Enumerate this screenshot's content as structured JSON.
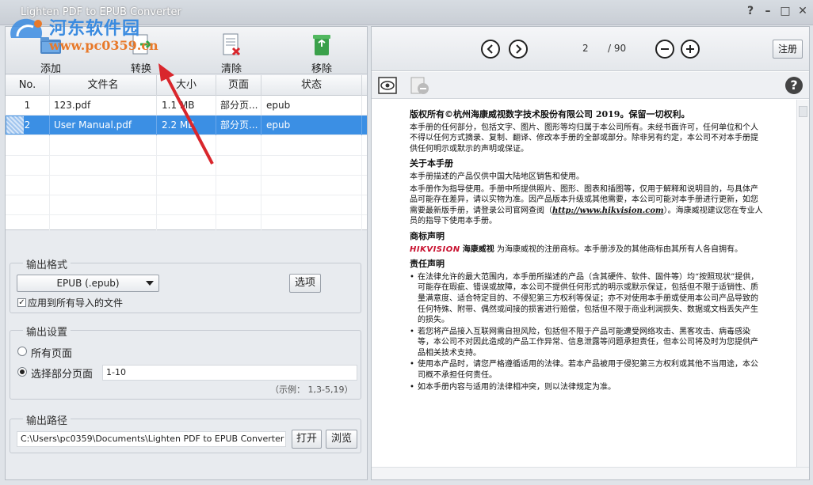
{
  "app": {
    "title": "Lighten PDF to EPUB Converter"
  },
  "watermark": {
    "name": "河东软件园",
    "url": "www.pc0359.cn"
  },
  "window_controls": {
    "help": "?",
    "minimize": "–",
    "maximize": "□",
    "close": "✕"
  },
  "toolbar": {
    "add_label": "添加",
    "convert_label": "转换",
    "clear_label": "清除",
    "remove_label": "移除"
  },
  "table": {
    "headers": {
      "no": "No.",
      "name": "文件名",
      "size": "大小",
      "pages": "页面",
      "status": "状态"
    },
    "rows": [
      {
        "no": "1",
        "name": "123.pdf",
        "size": "1.1 MB",
        "pages": "部分页...",
        "status": "epub"
      },
      {
        "no": "2",
        "name": "User Manual.pdf",
        "size": "2.2 MB",
        "pages": "部分页...",
        "status": "epub"
      }
    ]
  },
  "output_format": {
    "title": "输出格式",
    "selected": "EPUB (.epub)",
    "options_button": "选项",
    "apply_all_label": "应用到所有导入的文件"
  },
  "output_settings": {
    "title": "输出设置",
    "all_pages_label": "所有页面",
    "select_pages_label": "选择部分页面",
    "pages_value": "1-10",
    "example_hint": "（示例： 1,3-5,19）"
  },
  "output_path": {
    "title": "输出路径",
    "path_value": "C:\\Users\\pc0359\\Documents\\Lighten PDF to EPUB Converter",
    "open_button": "打开",
    "browse_button": "浏览"
  },
  "preview": {
    "current_page": "2",
    "total_pages": "/ 90",
    "register_button": "注册",
    "help_label": "?"
  },
  "document": {
    "copyright_title": "版权所有©杭州海康威视数字技术股份有限公司 2019。保留一切权利。",
    "copyright_body": "本手册的任何部分，包括文字、图片、图形等均归属于本公司所有。未经书面许可，任何单位和个人不得以任何方式摘录、复制、翻译、修改本手册的全部或部分。除非另有约定，本公司不对本手册提供任何明示或默示的声明或保证。",
    "about_title": "关于本手册",
    "about_p1": "本手册描述的产品仅供中国大陆地区销售和使用。",
    "about_p2_a": "本手册作为指导使用。手册中所提供照片、图形、图表和插图等，仅用于解释和说明目的，与具体产品可能存在差异，请以实物为准。因产品版本升级或其他需要，本公司可能对本手册进行更新，如您需要最新版手册，请登录公司官网查阅（",
    "about_url": "http://www.hikvision.com",
    "about_p2_b": "）。海康威视建议您在专业人员的指导下使用本手册。",
    "trademark_title": "商标声明",
    "brand_en": "HIKVISION",
    "brand_cn": "海康威视",
    "trademark_body": "为海康威视的注册商标。本手册涉及的其他商标由其所有人各自拥有。",
    "liability_title": "责任声明",
    "liability_items": [
      "在法律允许的最大范围内，本手册所描述的产品（含其硬件、软件、固件等）均“按照现状”提供，可能存在瑕疵、错误或故障，本公司不提供任何形式的明示或默示保证，包括但不限于适销性、质量满意度、适合特定目的、不侵犯第三方权利等保证；亦不对使用本手册或使用本公司产品导致的任何特殊、附带、偶然或间接的损害进行赔偿，包括但不限于商业利润损失、数据或文档丢失产生的损失。",
      "若您将产品接入互联网需自担风险，包括但不限于产品可能遭受网络攻击、黑客攻击、病毒感染等，本公司不对因此造成的产品工作异常、信息泄露等问题承担责任，但本公司将及时为您提供产品相关技术支持。",
      "使用本产品时，请您严格遵循适用的法律。若本产品被用于侵犯第三方权利或其他不当用途，本公司概不承担任何责任。",
      "如本手册内容与适用的法律相冲突，则以法律规定为准。"
    ]
  },
  "colors": {
    "selection": "#3b8fe4",
    "watermark_blue": "#3a8be0",
    "watermark_orange": "#e8792a",
    "annotation_arrow": "#d9262c",
    "brand_red": "#c8102e"
  }
}
